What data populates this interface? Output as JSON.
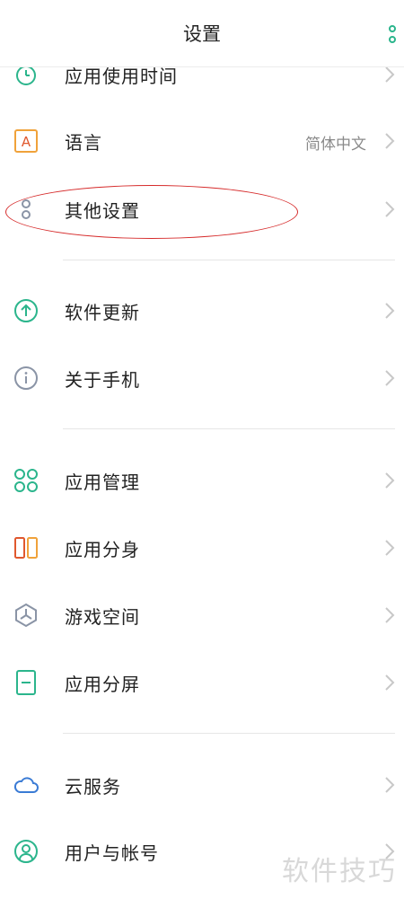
{
  "header": {
    "title": "设置",
    "more_icon": "more-vertical-icon"
  },
  "items": [
    {
      "label": "应用使用时间",
      "value": "",
      "icon": "timer-icon"
    },
    {
      "label": "语言",
      "value": "简体中文",
      "icon": "language-icon"
    },
    {
      "label": "其他设置",
      "value": "",
      "icon": "other-settings-icon"
    },
    {
      "label": "软件更新",
      "value": "",
      "icon": "update-icon"
    },
    {
      "label": "关于手机",
      "value": "",
      "icon": "info-icon"
    },
    {
      "label": "应用管理",
      "value": "",
      "icon": "app-manage-icon"
    },
    {
      "label": "应用分身",
      "value": "",
      "icon": "app-clone-icon"
    },
    {
      "label": "游戏空间",
      "value": "",
      "icon": "game-space-icon"
    },
    {
      "label": "应用分屏",
      "value": "",
      "icon": "split-screen-icon"
    },
    {
      "label": "云服务",
      "value": "",
      "icon": "cloud-icon"
    },
    {
      "label": "用户与帐号",
      "value": "",
      "icon": "account-icon"
    }
  ],
  "watermark": "软件技巧",
  "colors": {
    "accent_green": "#2bb58c",
    "orange": "#f0a23a",
    "annotation_red": "#d62b2b"
  }
}
